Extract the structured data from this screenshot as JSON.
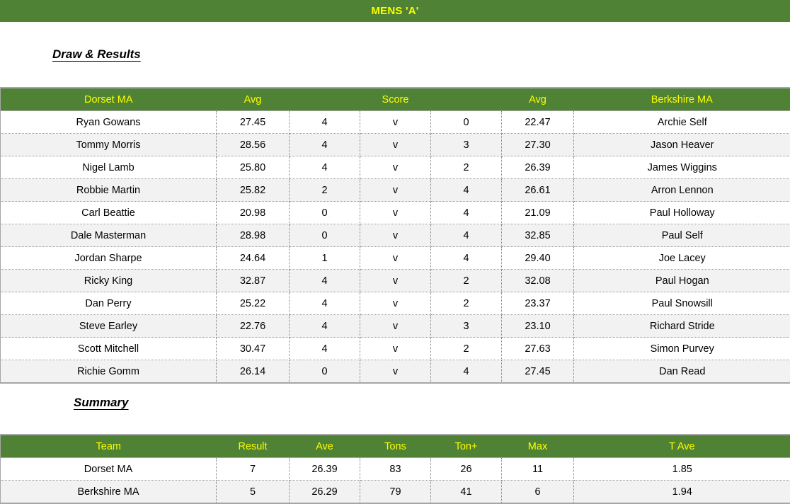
{
  "banner": {
    "title": "MENS 'A'"
  },
  "sections": {
    "draw_heading": "Draw & Results",
    "summary_heading": "Summary"
  },
  "colors": {
    "header_green": "#4F8234",
    "header_text_yellow": "#FFFF00",
    "alt_row": "#F2F2F2",
    "grid_line": "#A6A6A6"
  },
  "draw_table": {
    "headers": [
      "Dorset MA",
      "Avg",
      "",
      "Score",
      "",
      "Avg",
      "Berkshire MA"
    ],
    "rows": [
      {
        "home_player": "Ryan Gowans",
        "home_avg": "27.45",
        "home_score": "4",
        "v": "v",
        "away_score": "0",
        "away_avg": "22.47",
        "away_player": "Archie Self"
      },
      {
        "home_player": "Tommy Morris",
        "home_avg": "28.56",
        "home_score": "4",
        "v": "v",
        "away_score": "3",
        "away_avg": "27.30",
        "away_player": "Jason Heaver"
      },
      {
        "home_player": "Nigel Lamb",
        "home_avg": "25.80",
        "home_score": "4",
        "v": "v",
        "away_score": "2",
        "away_avg": "26.39",
        "away_player": "James Wiggins"
      },
      {
        "home_player": "Robbie Martin",
        "home_avg": "25.82",
        "home_score": "2",
        "v": "v",
        "away_score": "4",
        "away_avg": "26.61",
        "away_player": "Arron Lennon"
      },
      {
        "home_player": "Carl Beattie",
        "home_avg": "20.98",
        "home_score": "0",
        "v": "v",
        "away_score": "4",
        "away_avg": "21.09",
        "away_player": "Paul Holloway"
      },
      {
        "home_player": "Dale Masterman",
        "home_avg": "28.98",
        "home_score": "0",
        "v": "v",
        "away_score": "4",
        "away_avg": "32.85",
        "away_player": "Paul Self"
      },
      {
        "home_player": "Jordan Sharpe",
        "home_avg": "24.64",
        "home_score": "1",
        "v": "v",
        "away_score": "4",
        "away_avg": "29.40",
        "away_player": "Joe Lacey"
      },
      {
        "home_player": "Ricky King",
        "home_avg": "32.87",
        "home_score": "4",
        "v": "v",
        "away_score": "2",
        "away_avg": "32.08",
        "away_player": "Paul Hogan"
      },
      {
        "home_player": "Dan Perry",
        "home_avg": "25.22",
        "home_score": "4",
        "v": "v",
        "away_score": "2",
        "away_avg": "23.37",
        "away_player": "Paul Snowsill"
      },
      {
        "home_player": "Steve Earley",
        "home_avg": "22.76",
        "home_score": "4",
        "v": "v",
        "away_score": "3",
        "away_avg": "23.10",
        "away_player": "Richard Stride"
      },
      {
        "home_player": "Scott Mitchell",
        "home_avg": "30.47",
        "home_score": "4",
        "v": "v",
        "away_score": "2",
        "away_avg": "27.63",
        "away_player": "Simon Purvey"
      },
      {
        "home_player": "Richie Gomm",
        "home_avg": "26.14",
        "home_score": "0",
        "v": "v",
        "away_score": "4",
        "away_avg": "27.45",
        "away_player": "Dan Read"
      }
    ]
  },
  "summary_table": {
    "headers": [
      "Team",
      "Result",
      "Ave",
      "Tons",
      "Ton+",
      "Max",
      "T Ave"
    ],
    "rows": [
      {
        "team": "Dorset MA",
        "result": "7",
        "ave": "26.39",
        "tons": "83",
        "ton_plus": "26",
        "max": "11",
        "t_ave": "1.85"
      },
      {
        "team": "Berkshire MA",
        "result": "5",
        "ave": "26.29",
        "tons": "79",
        "ton_plus": "41",
        "max": "6",
        "t_ave": "1.94"
      }
    ]
  }
}
